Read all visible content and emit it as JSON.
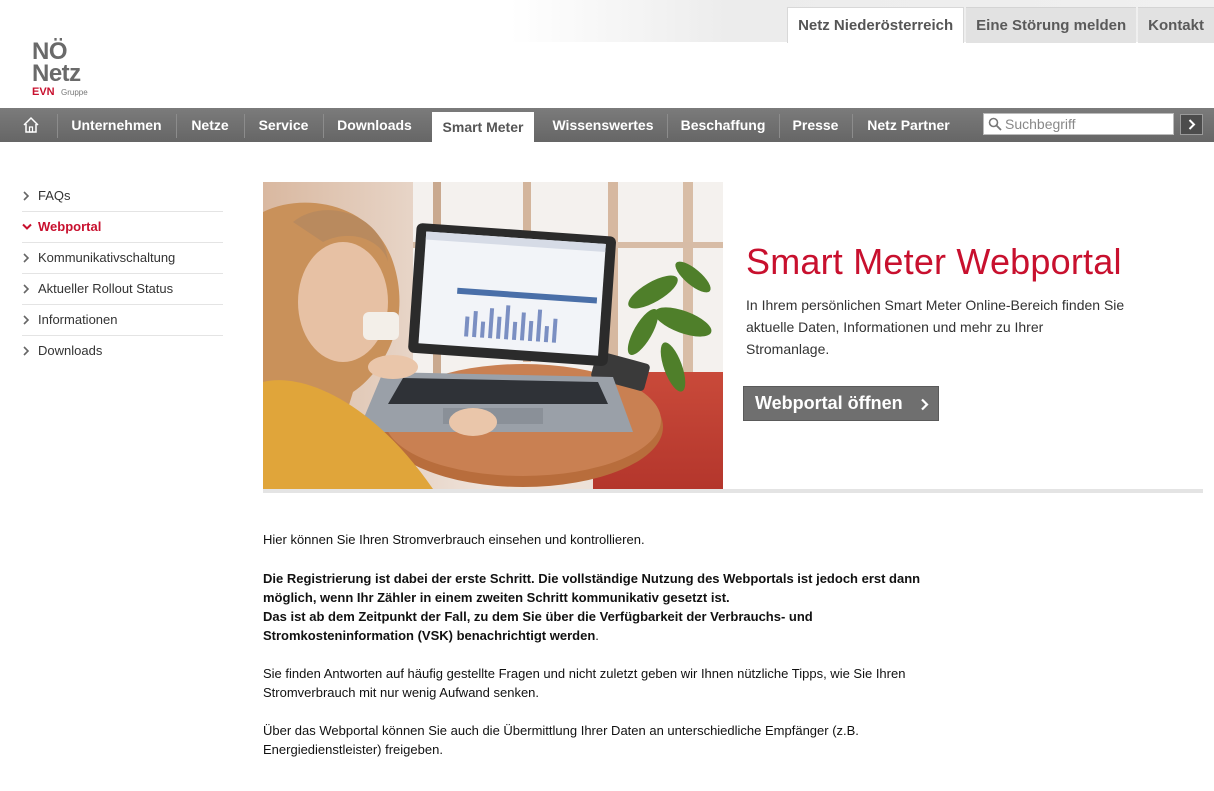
{
  "colors": {
    "brand_red": "#c8102e",
    "nav_gray": "#6f6f6f"
  },
  "top_links": [
    {
      "label": "Netz Niederösterreich"
    },
    {
      "label": "Eine Störung melden"
    },
    {
      "label": "Kontakt"
    }
  ],
  "logo": {
    "line1": "NÖ",
    "line2": "Netz",
    "evn": "EVN",
    "gruppe": "Gruppe"
  },
  "nav": {
    "home_icon": "home-icon",
    "items": [
      {
        "label": "Unternehmen"
      },
      {
        "label": "Netze"
      },
      {
        "label": "Service"
      },
      {
        "label": "Downloads"
      },
      {
        "label": "Smart Meter"
      },
      {
        "label": "Wissenswertes"
      },
      {
        "label": "Beschaffung"
      },
      {
        "label": "Presse"
      },
      {
        "label": "Netz Partner"
      }
    ],
    "active": "Smart Meter",
    "search_placeholder": "Suchbegriff"
  },
  "sidebar": {
    "items": [
      {
        "label": "FAQs"
      },
      {
        "label": "Webportal"
      },
      {
        "label": "Kommunikativschaltung"
      },
      {
        "label": "Aktueller Rollout Status"
      },
      {
        "label": "Informationen"
      },
      {
        "label": "Downloads"
      }
    ],
    "active": "Webportal"
  },
  "hero": {
    "title": "Smart Meter Webportal",
    "text": "In Ihrem persönlichen Smart Meter Online-Bereich finden Sie aktuelle Daten, Informationen und mehr zu Ihrer Stromanlage.",
    "button_label": "Webportal öffnen"
  },
  "content": {
    "p1": "Hier können Sie Ihren Stromverbrauch einsehen und kontrollieren.",
    "p2_line1": "Die Registrierung ist dabei der erste Schritt. Die vollständige Nutzung des Webportals ist jedoch erst dann möglich, wenn Ihr Zähler in einem zweiten Schritt kommunikativ gesetzt ist.",
    "p2_line2": "Das ist ab dem Zeitpunkt der Fall, zu dem Sie über die Verfügbarkeit der Verbrauchs- und Stromkosteninformation (VSK) benachrichtigt werden",
    "p2_tail": ".",
    "p3": "Sie finden Antworten auf häufig gestellte Fragen und nicht zuletzt geben wir Ihnen nützliche Tipps, wie Sie Ihren Stromverbrauch mit nur wenig Aufwand senken.",
    "p4": "Über das Webportal können Sie auch die Übermittlung Ihrer Daten an unterschiedliche Empfänger (z.B. Energiedienstleister) freigeben."
  }
}
